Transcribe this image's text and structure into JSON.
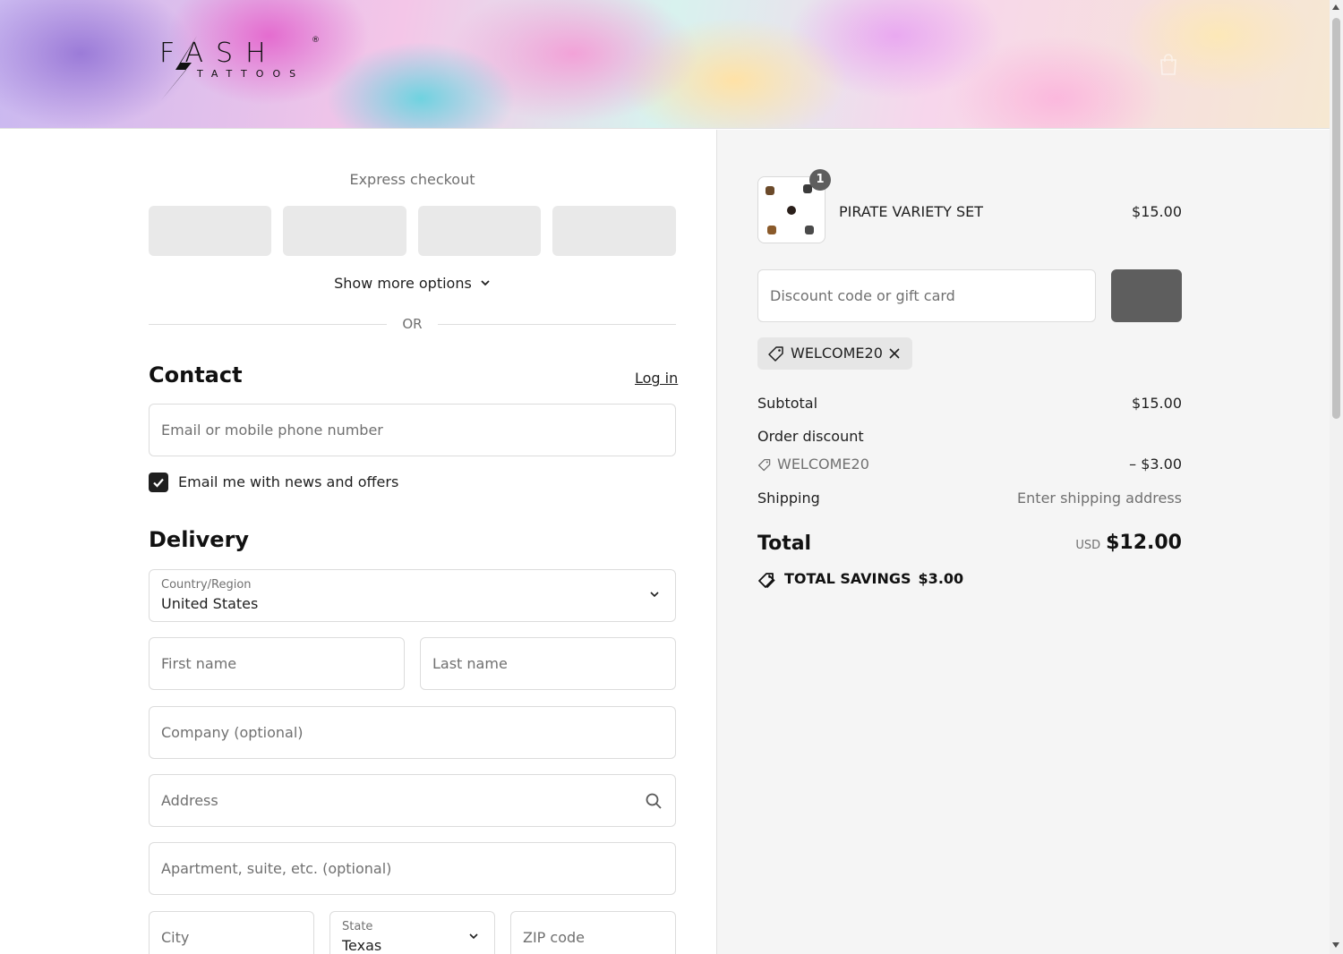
{
  "header": {
    "brand_top": "FASH",
    "brand_bottom": "TATTOOS",
    "registered_mark": "®"
  },
  "express": {
    "title": "Express checkout",
    "wallet_buttons": 4,
    "show_more_label": "Show more options",
    "or_label": "OR"
  },
  "contact": {
    "heading": "Contact",
    "login_label": "Log in",
    "email_placeholder": "Email or mobile phone number",
    "news_checkbox_checked": true,
    "news_label": "Email me with news and offers"
  },
  "delivery": {
    "heading": "Delivery",
    "country_label": "Country/Region",
    "country_value": "United States",
    "first_name_placeholder": "First name",
    "last_name_placeholder": "Last name",
    "company_placeholder": "Company (optional)",
    "address_placeholder": "Address",
    "apartment_placeholder": "Apartment, suite, etc. (optional)",
    "city_placeholder": "City",
    "state_label": "State",
    "state_value": "Texas",
    "zip_placeholder": "ZIP code"
  },
  "summary": {
    "item": {
      "name": "PIRATE VARIETY SET",
      "price": "$15.00",
      "quantity": "1"
    },
    "discount_placeholder": "Discount code or gift card",
    "applied_code": "WELCOME20",
    "subtotal_label": "Subtotal",
    "subtotal_value": "$15.00",
    "order_discount_label": "Order discount",
    "order_discount_code": "WELCOME20",
    "order_discount_value": "– $3.00",
    "shipping_label": "Shipping",
    "shipping_value": "Enter shipping address",
    "total_label": "Total",
    "total_currency": "USD",
    "total_value": "$12.00",
    "savings_label": "TOTAL SAVINGS",
    "savings_value": "$3.00"
  },
  "colors": {
    "accent_dark": "#1f1f1f",
    "muted_text": "#707070",
    "button_gray": "#5e5e5e",
    "summary_bg": "#f5f5f5"
  }
}
